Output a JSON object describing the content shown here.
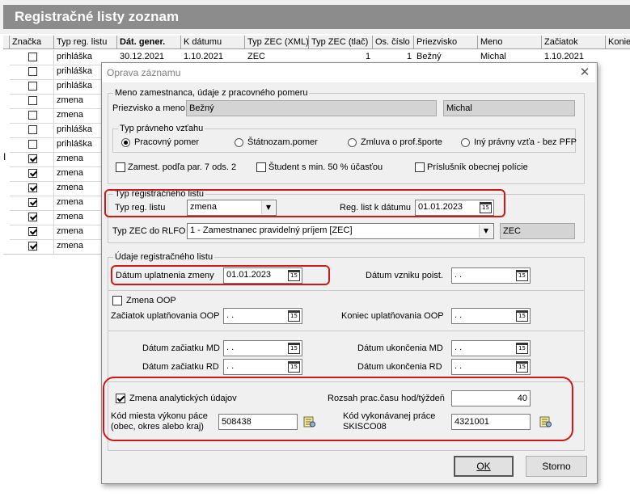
{
  "window": {
    "title": "Registračné listy zoznam"
  },
  "table": {
    "headers": [
      "Značka",
      "Typ reg. listu",
      "Dát. gener.",
      "K dátumu",
      "Typ ZEC (XML)",
      "Typ ZEC (tlač)",
      "Os. číslo",
      "Priezvisko",
      "Meno",
      "Začiatok",
      "Konie"
    ],
    "first_row": {
      "date_gen": "30.12.2021",
      "k_datumu": "1.10.2021",
      "zec_xml": "ZEC",
      "zec_tlac": "1",
      "os_cislo": "1",
      "priezvisko": "Bežný",
      "meno": "Michal",
      "zaciatok": "1.10.2021"
    },
    "rows": [
      {
        "checked": false,
        "type": "prihláška"
      },
      {
        "checked": false,
        "type": "prihláška"
      },
      {
        "checked": false,
        "type": "prihláška"
      },
      {
        "checked": false,
        "type": "zmena"
      },
      {
        "checked": false,
        "type": "zmena"
      },
      {
        "checked": false,
        "type": "prihláška"
      },
      {
        "checked": false,
        "type": "prihláška"
      },
      {
        "checked": true,
        "type": "zmena"
      },
      {
        "checked": true,
        "type": "zmena"
      },
      {
        "checked": true,
        "type": "zmena"
      },
      {
        "checked": true,
        "type": "zmena"
      },
      {
        "checked": true,
        "type": "zmena"
      },
      {
        "checked": true,
        "type": "zmena"
      },
      {
        "checked": true,
        "type": "zmena"
      }
    ],
    "cursor_glyph": "I"
  },
  "dialog": {
    "title": "Oprava záznamu",
    "close_glyph": "✕",
    "employee_group": {
      "legend": "Meno zamestnanca, údaje z pracovného pomeru",
      "name_label": "Priezvisko a meno",
      "surname": "Bežný",
      "firstname": "Michal",
      "relation_legend": "Typ právneho vzťahu",
      "relation_options": [
        "Pracovný pomer",
        "Štátnozam.pomer",
        "Zmluva o prof.športe",
        "Iný právny vzťa - bez PFP"
      ],
      "relation_selected": 0,
      "flags": [
        "Zamest. podľa par. 7 ods. 2",
        "Študent s min. 50 % účasťou",
        "Príslušník obecnej polície"
      ]
    },
    "reg_type_group": {
      "legend": "Typ registračného listu",
      "type_label": "Typ reg. listu",
      "type_value": "zmena",
      "date_label": "Reg. list k dátumu",
      "date_value": "01.01.2023",
      "zec_label": "Typ ZEC do RLFO",
      "zec_value": "1 - Zamestnanec pravidelný príjem [ZEC]",
      "zec_code": "ZEC"
    },
    "reg_data_group": {
      "legend": "Údaje registračného listu",
      "change_date_label": "Dátum uplatnenia zmeny",
      "change_date_value": "01.01.2023",
      "insurance_start_label": "Dátum vzniku poist.",
      "empty_date": " .  .",
      "oop_change_label": "Zmena OOP",
      "oop_start_label": "Začiatok uplatňovania OOP",
      "oop_end_label": "Koniec uplatňovania OOP",
      "md_start_label": "Dátum začiatku MD",
      "md_end_label": "Dátum ukončenia MD",
      "rd_start_label": "Dátum začiatku RD",
      "rd_end_label": "Dátum ukončenia RD",
      "analytic_label": "Zmena analytických údajov",
      "analytic_checked": true,
      "hours_label": "Rozsah prac.času hod/týždeň",
      "hours_value": "40",
      "place_label_1": "Kód miesta výkonu páce",
      "place_label_2": "(obec, okres alebo kraj)",
      "place_value": "508438",
      "job_label_1": "Kód vykonávanej práce",
      "job_label_2": "SKISCO08",
      "job_value": "4321001"
    },
    "buttons": {
      "ok": "OK",
      "cancel": "Storno"
    },
    "cal_glyph": "15",
    "combo_arrow": "▼"
  },
  "colors": {
    "title_bar": "#8c8c8c",
    "highlight": "#d01818",
    "dialog_bg": "#f0f0f0"
  }
}
